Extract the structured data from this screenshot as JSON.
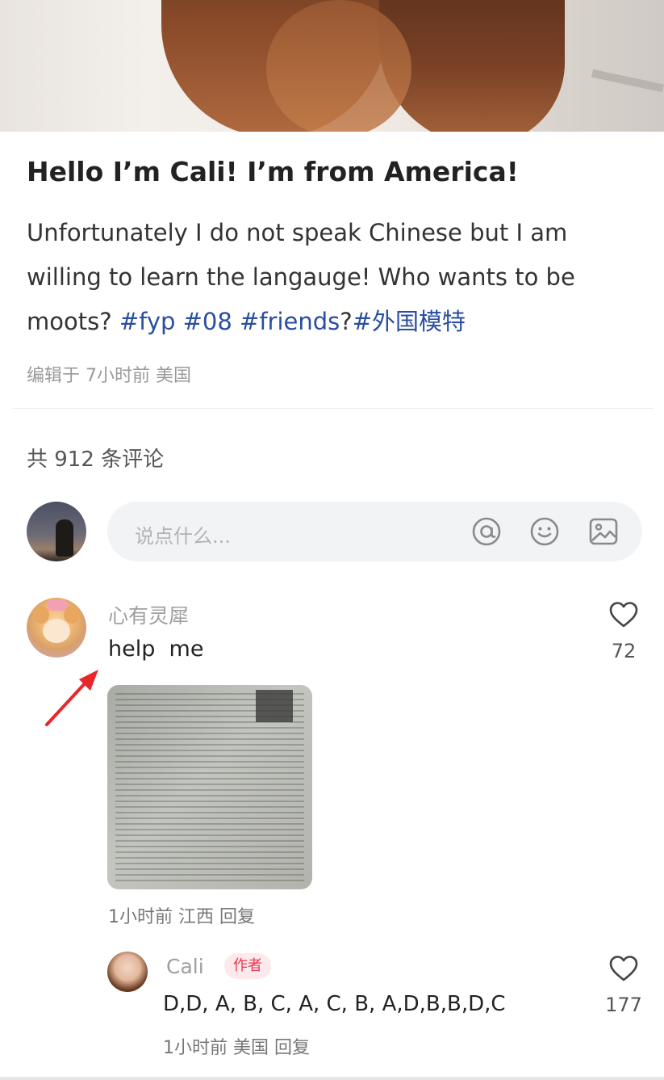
{
  "post": {
    "title": "Hello I’m Cali! I’m from America!",
    "body_prefix": "Unfortunately I do not speak Chinese but I am willing to learn the langauge! Who wants to be moots?",
    "tags": [
      "#fyp",
      "#08",
      "#friends"
    ],
    "tag_separator": "?",
    "tag_last": "#外国模特",
    "meta": "编辑于 7小时前 美国"
  },
  "comments_header": {
    "count_text": "共 912 条评论"
  },
  "comment_input": {
    "placeholder": "说点什么...",
    "icons": [
      "at-icon",
      "emoji-icon",
      "image-icon"
    ]
  },
  "comment": {
    "username": "心有灵犀",
    "text": "help  me",
    "likes": "72",
    "meta": "1小时前 江西 回复"
  },
  "reply": {
    "username": "Cali",
    "badge": "作者",
    "text": "D,D, A, B, C, A, C, B, A,D,B,B,D,C",
    "likes": "177",
    "meta": "1小时前 美国 回复"
  },
  "colors": {
    "tag": "#2a4ea0",
    "badge_bg": "#fde9ec",
    "badge_text": "#e6364f",
    "arrow": "#e8262b"
  }
}
